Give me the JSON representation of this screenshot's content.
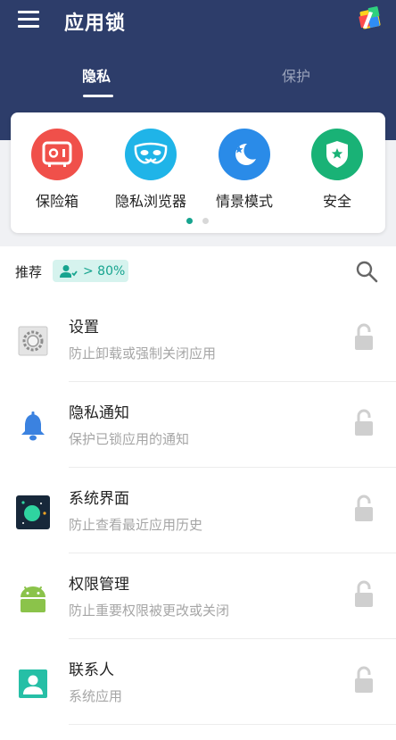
{
  "header": {
    "title": "应用锁",
    "tabs": [
      {
        "label": "隐私",
        "active": true
      },
      {
        "label": "保护",
        "active": false
      }
    ]
  },
  "features": [
    {
      "label": "保险箱",
      "icon": "safe-box-icon",
      "color": "#f0504a"
    },
    {
      "label": "隐私浏览器",
      "icon": "mask-icon",
      "color": "#1fb4e8"
    },
    {
      "label": "情景模式",
      "icon": "moon-icon",
      "color": "#2a8be8"
    },
    {
      "label": "安全",
      "icon": "shield-icon",
      "color": "#19b276"
    }
  ],
  "pager": {
    "pages": 2,
    "active_page": 1
  },
  "recommend": {
    "label": "推荐",
    "badge_text": "> 80%",
    "badge_icon": "users-icon"
  },
  "apps": [
    {
      "name": "设置",
      "desc": "防止卸载或强制关闭应用",
      "icon": "settings-app-icon",
      "locked": false
    },
    {
      "name": "隐私通知",
      "desc": "保护已锁应用的通知",
      "icon": "bell-icon",
      "locked": false
    },
    {
      "name": "系统界面",
      "desc": "防止查看最近应用历史",
      "icon": "system-ui-icon",
      "locked": false
    },
    {
      "name": "权限管理",
      "desc": "防止重要权限被更改或关闭",
      "icon": "android-icon",
      "locked": false
    },
    {
      "name": "联系人",
      "desc": "系统应用",
      "icon": "contacts-icon",
      "locked": false
    }
  ],
  "colors": {
    "header_bg": "#2d3d6a",
    "accent": "#17a48f",
    "lock_icon": "#cfcfcf"
  }
}
